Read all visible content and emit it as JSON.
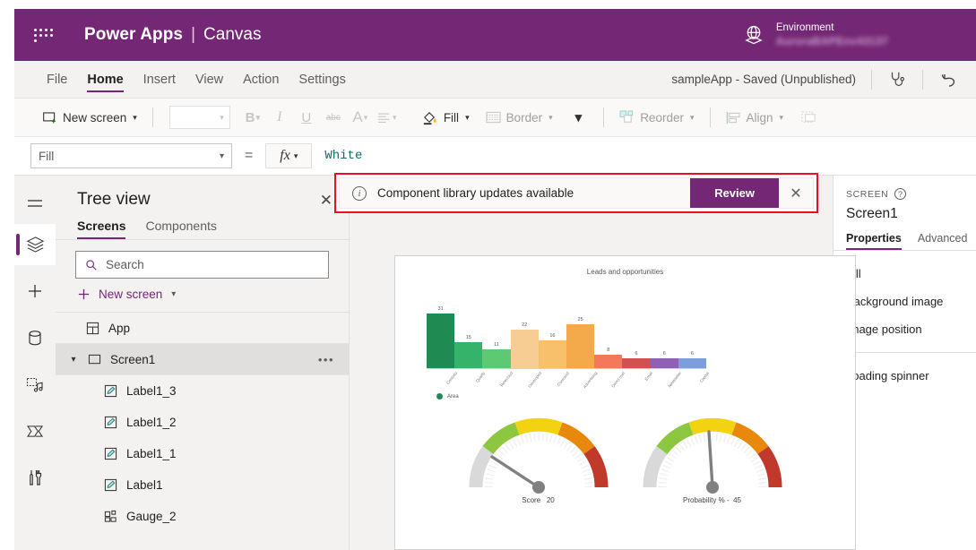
{
  "brand": {
    "waffle_icon": "waffle-grid-icon",
    "title": "Power Apps",
    "separator": "|",
    "subtitle": "Canvas",
    "env_icon": "globe-icon",
    "env_label": "Environment",
    "env_name": "AuroraBAPEnv43137"
  },
  "menubar": {
    "items": [
      {
        "label": "File",
        "active": false
      },
      {
        "label": "Home",
        "active": true
      },
      {
        "label": "Insert",
        "active": false
      },
      {
        "label": "View",
        "active": false
      },
      {
        "label": "Action",
        "active": false
      },
      {
        "label": "Settings",
        "active": false
      }
    ],
    "save_status": "sampleApp - Saved (Unpublished)",
    "checker_icon": "stethoscope-icon",
    "undo_icon": "undo-arrow-icon"
  },
  "ribbon": {
    "new_screen": "New screen",
    "new_screen_icon": "new-screen-icon",
    "font_value": "",
    "bold": "B",
    "italic": "I",
    "underline": "U",
    "strikethrough": "abc",
    "font_color": "A",
    "align_icon": "align-left-icon",
    "fill": "Fill",
    "fill_icon": "paint-bucket-icon",
    "border": "Border",
    "border_icon": "border-icon",
    "more_icon": "chevron-down-icon",
    "reorder": "Reorder",
    "reorder_icon": "reorder-icon",
    "align": "Align",
    "align_group_icon": "align-objects-icon",
    "group_icon": "group-icon"
  },
  "formulabar": {
    "property": "Fill",
    "equals": "=",
    "fx": "fx",
    "value": "White"
  },
  "rail": {
    "items": [
      {
        "name": "hamburger-menu-icon",
        "selected": false
      },
      {
        "name": "tree-view-layers-icon",
        "selected": true
      },
      {
        "name": "insert-plus-icon",
        "selected": false
      },
      {
        "name": "data-cylinder-icon",
        "selected": false
      },
      {
        "name": "media-icon",
        "selected": false
      },
      {
        "name": "power-automate-flow-icon",
        "selected": false
      },
      {
        "name": "variables-tools-icon",
        "selected": false
      }
    ]
  },
  "treeview": {
    "title": "Tree view",
    "close_icon": "close-icon",
    "tabs": [
      {
        "label": "Screens",
        "active": true
      },
      {
        "label": "Components",
        "active": false
      }
    ],
    "search_placeholder": "Search",
    "search_icon": "search-icon",
    "search_value": "",
    "new_screen": "New screen",
    "new_screen_icon": "plus-icon",
    "items": [
      {
        "label": "App",
        "icon": "app-icon",
        "level": "app",
        "selected": false
      },
      {
        "label": "Screen1",
        "icon": "screen-icon",
        "level": "screen",
        "selected": true,
        "overflow": "•••"
      },
      {
        "label": "Label1_3",
        "icon": "label-icon",
        "level": "child",
        "selected": false
      },
      {
        "label": "Label1_2",
        "icon": "label-icon",
        "level": "child",
        "selected": false
      },
      {
        "label": "Label1_1",
        "icon": "label-icon",
        "level": "child",
        "selected": false
      },
      {
        "label": "Label1",
        "icon": "label-icon",
        "level": "child",
        "selected": false
      },
      {
        "label": "Gauge_2",
        "icon": "gauge-component-icon",
        "level": "child",
        "selected": false
      }
    ]
  },
  "notification": {
    "info_icon": "info-circle-icon",
    "message": "Component library updates available",
    "review_button": "Review",
    "close_icon": "close-icon",
    "highlight_color": "#e81123",
    "button_color": "#742774"
  },
  "properties_panel": {
    "kind": "SCREEN",
    "help_icon": "question-circle-icon",
    "name": "Screen1",
    "tabs": [
      {
        "label": "Properties",
        "active": true
      },
      {
        "label": "Advanced",
        "active": false
      }
    ],
    "group1": [
      "Fill",
      "Background image",
      "Image position"
    ],
    "group2": [
      "Loading spinner"
    ]
  },
  "canvas": {
    "chart_data": [
      {
        "type": "bar",
        "title": "Leads and opportunities",
        "categories": [
          "Contoso",
          "Qualify",
          "Relecloud",
          "Developed",
          "Contoso2",
          "Advertising",
          "Direct mail",
          "Email",
          "Newsletter",
          "Capital"
        ],
        "values": [
          31,
          15,
          11,
          22,
          16,
          25,
          8,
          6,
          6,
          6
        ],
        "colors": [
          "#1f8a52",
          "#35b36a",
          "#5ec973",
          "#f7cd93",
          "#f8c06a",
          "#f4a94a",
          "#f2795a",
          "#d2504f",
          "#8f61b5",
          "#7a9fdc"
        ],
        "legend": [
          "Area"
        ],
        "legend_color": "#1f8a52",
        "legend_position": "bottom-left",
        "ylim": [
          0,
          34
        ],
        "xlabel": "",
        "ylabel": "",
        "grid": false
      },
      {
        "type": "gauge",
        "title": "Score",
        "caption": "Score",
        "value": 20,
        "min": 0,
        "max": 100
      },
      {
        "type": "gauge",
        "title": "Probability %",
        "caption": "Probability % -",
        "value": 45,
        "min": 0,
        "max": 100
      }
    ]
  }
}
